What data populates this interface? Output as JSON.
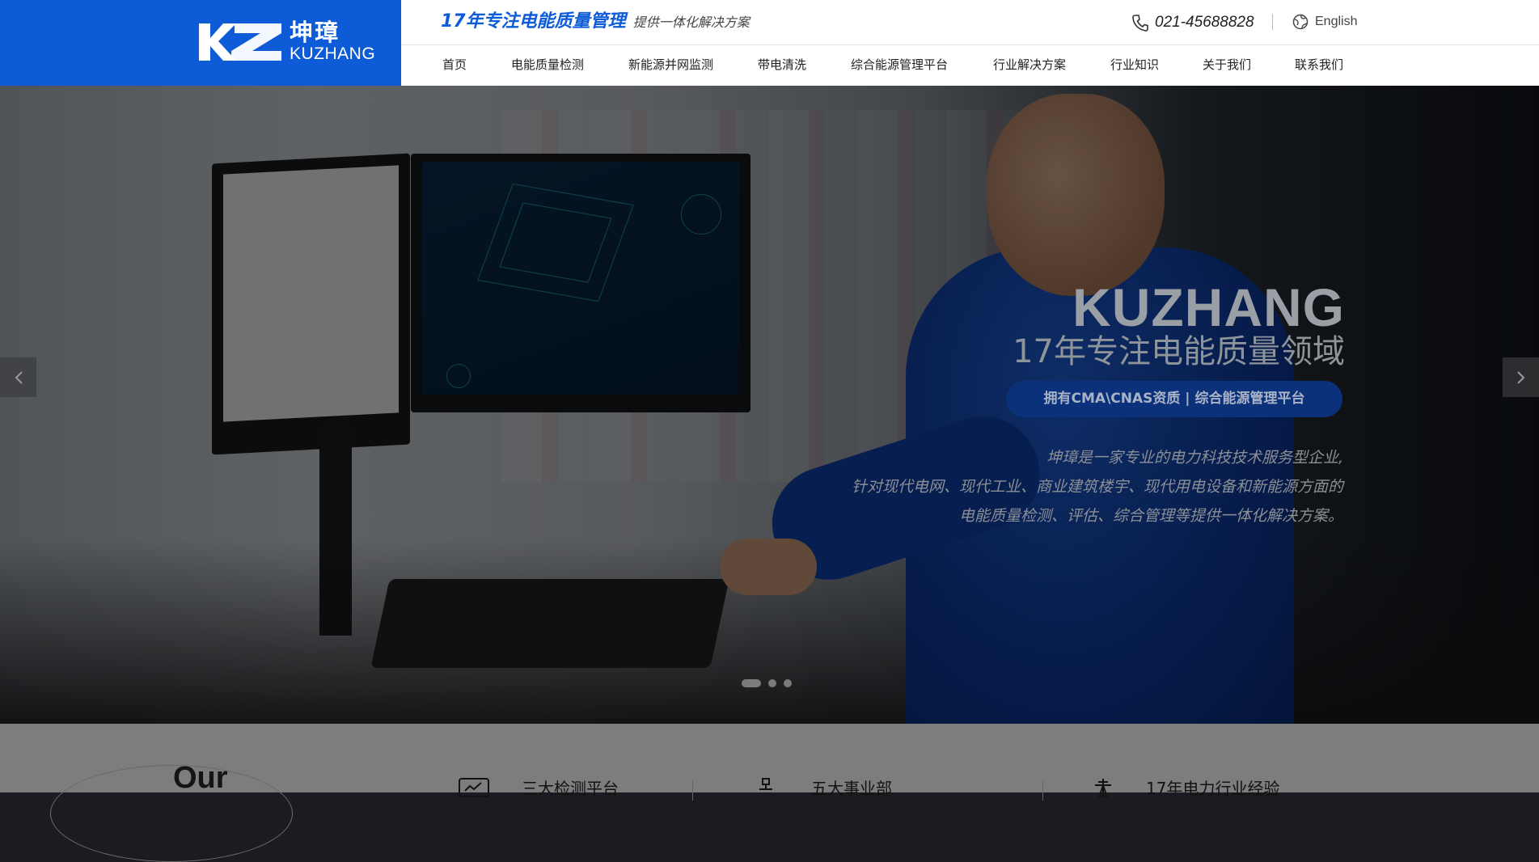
{
  "header": {
    "logo": {
      "mark": "KZ",
      "cn": "坤璋",
      "en": "KUZHANG"
    },
    "slogan_main": "17年专注电能质量管理",
    "slogan_sub": "提供一体化解决方案",
    "phone": "021-45688828",
    "language": "English",
    "brand_color": "#0e5bd8"
  },
  "nav": [
    {
      "label": "首页"
    },
    {
      "label": "电能质量检测"
    },
    {
      "label": "新能源并网监测"
    },
    {
      "label": "带电清洗"
    },
    {
      "label": "综合能源管理平台"
    },
    {
      "label": "行业解决方案"
    },
    {
      "label": "行业知识"
    },
    {
      "label": "关于我们"
    },
    {
      "label": "联系我们"
    }
  ],
  "hero": {
    "title": "KUZHANG",
    "subtitle": "17年专注电能质量领域",
    "badge": "拥有CMA\\CNAS资质  |  综合能源管理平台",
    "desc": [
      "坤璋是一家专业的电力科技技术服务型企业,",
      "针对现代电网、现代工业、商业建筑楼宇、现代用电设备和新能源方面的",
      "电能质量检测、评估、综合管理等提供一体化解决方案。"
    ],
    "slides": 3,
    "active_slide": 1
  },
  "about": {
    "heading": "Our",
    "features": [
      {
        "label": "三大检测平台",
        "icon": "monitor-icon"
      },
      {
        "label": "五大事业部",
        "icon": "org-chart-icon"
      },
      {
        "label": "17年电力行业经验",
        "icon": "tower-icon"
      }
    ]
  }
}
